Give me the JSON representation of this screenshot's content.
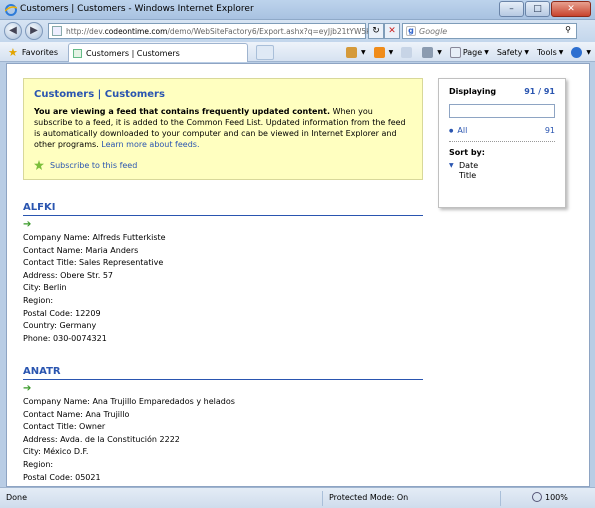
{
  "window": {
    "title": "Customers | Customers - Windows Internet Explorer"
  },
  "address": {
    "url_prefix": "http://dev.",
    "url_host": "codeontime.com",
    "url_rest": "/demo/WebSiteFactory6/Export.ashx?q=eyJjb21tYW5k"
  },
  "search": {
    "placeholder": "Google"
  },
  "cmdbar": {
    "favorites_label": "Favorites",
    "tab_label": "Customers | Customers",
    "page_label": "Page",
    "safety_label": "Safety",
    "tools_label": "Tools"
  },
  "feed": {
    "title": "Customers | Customers",
    "bold_text": "You are viewing a feed that contains frequently updated content.",
    "desc_text": " When you subscribe to a feed, it is added to the Common Feed List. Updated information from the feed is automatically downloaded to your computer and can be viewed in Internet Explorer and other programs. ",
    "learn_more": "Learn more about feeds.",
    "subscribe_label": "Subscribe to this feed"
  },
  "sidebar": {
    "displaying_label": "Displaying",
    "displaying_count": "91 / 91",
    "all_label": "All",
    "all_count": "91",
    "sort_by_label": "Sort by:",
    "sort_options": [
      "Date",
      "Title"
    ]
  },
  "entries": [
    {
      "heading": "ALFKI",
      "fields": [
        "Company Name: Alfreds Futterkiste",
        "Contact Name: Maria Anders",
        "Contact Title: Sales Representative",
        "Address: Obere Str. 57",
        "City: Berlin",
        "Region:",
        "Postal Code: 12209",
        "Country: Germany",
        "Phone: 030-0074321"
      ]
    },
    {
      "heading": "ANATR",
      "fields": [
        "Company Name: Ana Trujillo Emparedados y helados",
        "Contact Name: Ana Trujillo",
        "Contact Title: Owner",
        "Address: Avda. de la Constitución 2222",
        "City: México D.F.",
        "Region:",
        "Postal Code: 05021"
      ]
    }
  ],
  "status": {
    "left_text": "Done",
    "protected_mode": "Protected Mode: On",
    "zoom": "100%"
  },
  "colors": {
    "link": "#2a55b0",
    "feed_bg": "#ffffc0",
    "arrow": "#3a9a2a"
  }
}
